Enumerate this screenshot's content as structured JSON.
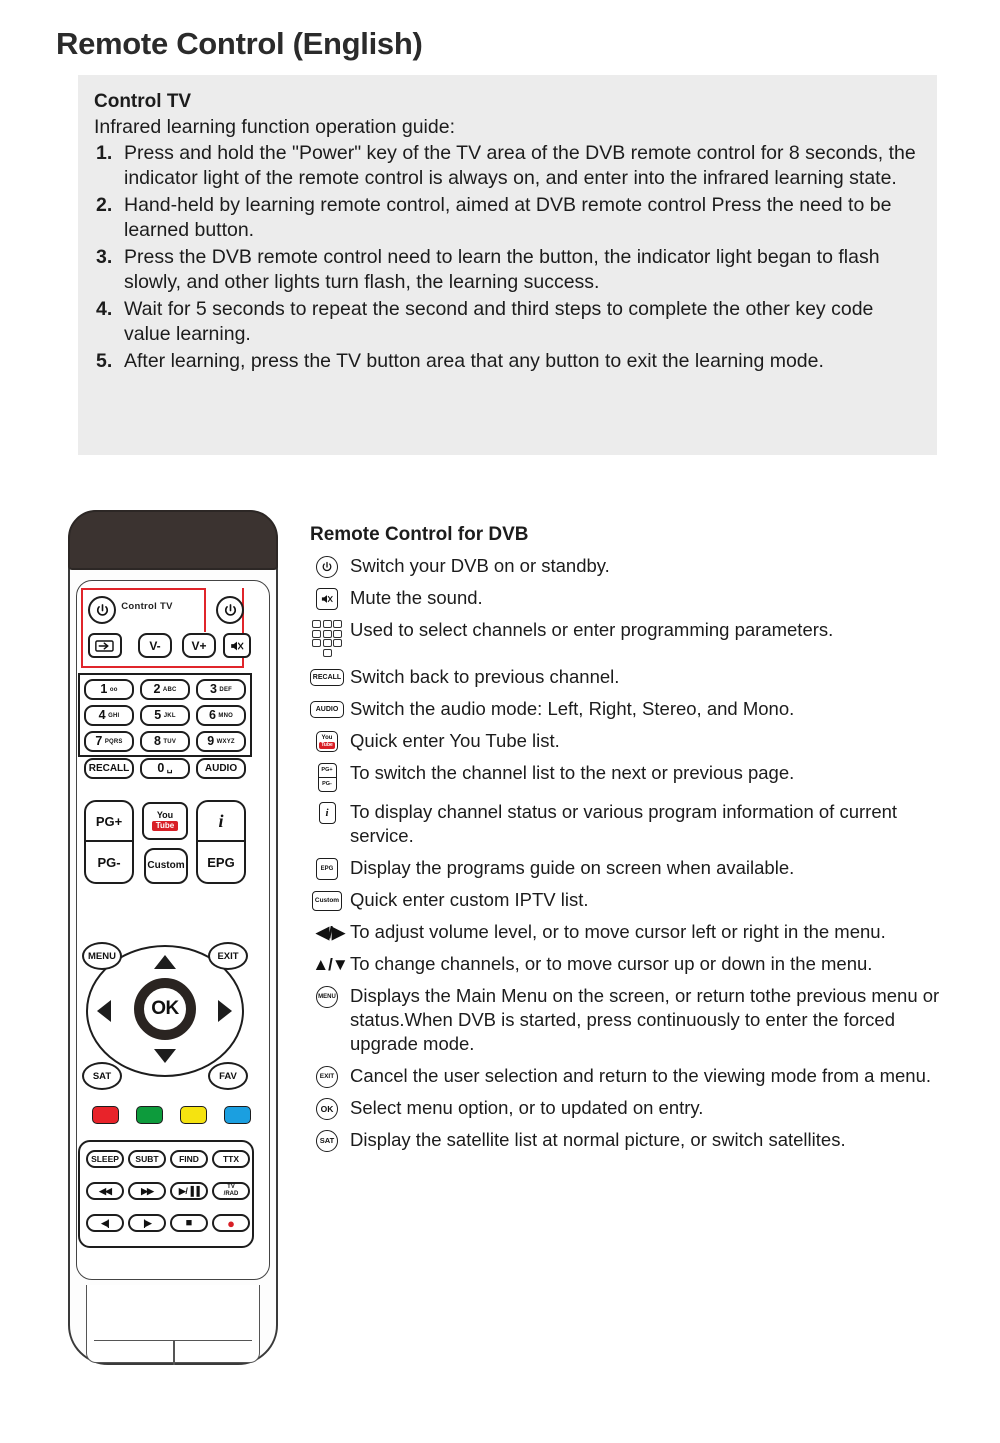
{
  "page": {
    "title": "Remote Control (English)"
  },
  "instructions": {
    "heading": "Control TV",
    "subheading": "Infrared learning function operation guide:",
    "steps": [
      {
        "num": "1.",
        "text": "Press and hold the \"Power\" key of the TV area of the DVB remote control for 8 seconds, the indicator light of the remote control is always on, and enter into the infrared learning state."
      },
      {
        "num": "2.",
        "text": "Hand-held by learning remote control, aimed at DVB remote control Press the need to be learned button."
      },
      {
        "num": "3.",
        "text": "Press the DVB remote control need to learn the button, the indicator light began to flash slowly, and other lights turn flash, the learning success."
      },
      {
        "num": "4.",
        "text": "Wait for 5 seconds to repeat the second and third steps to complete the other key code value learning."
      },
      {
        "num": "5.",
        "text": "After learning, press the TV button area that any button to exit the learning mode."
      }
    ]
  },
  "remote": {
    "control_tv_label": "Control TV",
    "power_tv": "power-icon",
    "power_dvb": "power-icon",
    "source": "source-icon",
    "vol_down": "V-",
    "vol_up": "V+",
    "mute": "mute-icon",
    "numpad": [
      {
        "digit": "1",
        "letters": "oo"
      },
      {
        "digit": "2",
        "letters": "ABC"
      },
      {
        "digit": "3",
        "letters": "DEF"
      },
      {
        "digit": "4",
        "letters": "GHI"
      },
      {
        "digit": "5",
        "letters": "JKL"
      },
      {
        "digit": "6",
        "letters": "MNO"
      },
      {
        "digit": "7",
        "letters": "PQRS"
      },
      {
        "digit": "8",
        "letters": "TUV"
      },
      {
        "digit": "9",
        "letters": "WXYZ"
      }
    ],
    "recall": "RECALL",
    "zero": {
      "digit": "0",
      "letters": "␣"
    },
    "audio": "AUDIO",
    "pg_up": "PG+",
    "pg_down": "PG-",
    "youtube_you": "You",
    "youtube_tube": "Tube",
    "custom": "Custom",
    "info": "i",
    "epg": "EPG",
    "menu": "MENU",
    "exit": "EXIT",
    "ok": "OK",
    "sat": "SAT",
    "fav": "FAV",
    "color_buttons": [
      {
        "name": "red",
        "hex": "#e8232a"
      },
      {
        "name": "green",
        "hex": "#0d9b3c"
      },
      {
        "name": "yellow",
        "hex": "#f5e310"
      },
      {
        "name": "blue",
        "hex": "#1b9fe0"
      }
    ],
    "media": {
      "sleep": "SLEEP",
      "subt": "SUBT",
      "find": "FIND",
      "ttx": "TTX",
      "rewind": "◀◀",
      "forward": "▶▶",
      "play_pause": "▶/▐▐",
      "tv_rad_line1": "TV",
      "tv_rad_line2": "/RAD",
      "prev_frame": "◀|",
      "next_frame": "|▶",
      "stop": "■",
      "record": "●"
    },
    "record_color": "#d81f26"
  },
  "legend": {
    "title": "Remote Control for DVB",
    "rows": [
      {
        "icon": "power-icon",
        "icon_label": "⏻",
        "icon_type": "circle",
        "text": "Switch your DVB on or standby."
      },
      {
        "icon": "mute-icon",
        "icon_label": "«",
        "icon_type": "box",
        "text": "Mute the sound."
      },
      {
        "icon": "keypad-icon",
        "icon_label": "",
        "icon_type": "keypad",
        "text": "Used to select channels or enter programming parameters."
      },
      {
        "icon": "recall-key-icon",
        "icon_label": "RECALL",
        "icon_type": "box",
        "text": "Switch back to previous channel."
      },
      {
        "icon": "audio-key-icon",
        "icon_label": "AUDIO",
        "icon_type": "box",
        "text": "Switch the audio mode: Left, Right, Stereo, and Mono."
      },
      {
        "icon": "youtube-key-icon",
        "icon_label": "",
        "icon_type": "youtube",
        "text": "Quick enter You Tube list."
      },
      {
        "icon": "page-key-icon",
        "icon_label": "",
        "icon_type": "pgstack",
        "text": "To switch the channel list to the next or previous page."
      },
      {
        "icon": "info-key-icon",
        "icon_label": "i",
        "icon_type": "box",
        "text": "To display channel status or various program information of current service."
      },
      {
        "icon": "epg-key-icon",
        "icon_label": "EPG",
        "icon_type": "box",
        "text": "Display the programs guide on screen when available."
      },
      {
        "icon": "custom-key-icon",
        "icon_label": "Custom",
        "icon_type": "box",
        "text": "Quick enter custom IPTV list."
      },
      {
        "icon": "left-right-arrow-icon",
        "icon_label": "◀/▶",
        "icon_type": "arrows",
        "text": "To adjust volume level, or to move cursor left or right in the menu."
      },
      {
        "icon": "up-down-arrow-icon",
        "icon_label": "▲/▼",
        "icon_type": "arrows",
        "text": "To change channels, or to move cursor up or down  in the menu."
      },
      {
        "icon": "menu-key-icon",
        "icon_label": "MENU",
        "icon_type": "circle",
        "text": "Displays the Main Menu on the screen, or return tothe previous menu or status.When DVB is started, press continuously to enter the forced upgrade mode."
      },
      {
        "icon": "exit-key-icon",
        "icon_label": "EXIT",
        "icon_type": "circle",
        "text": "Cancel the user selection and return to the viewing mode from  a menu."
      },
      {
        "icon": "ok-key-icon",
        "icon_label": "OK",
        "icon_type": "circle",
        "text": "Select menu option, or to updated on entry."
      },
      {
        "icon": "sat-key-icon",
        "icon_label": "SAT",
        "icon_type": "circle",
        "text": "Display the satellite list at normal picture, or switch satellites."
      }
    ]
  }
}
